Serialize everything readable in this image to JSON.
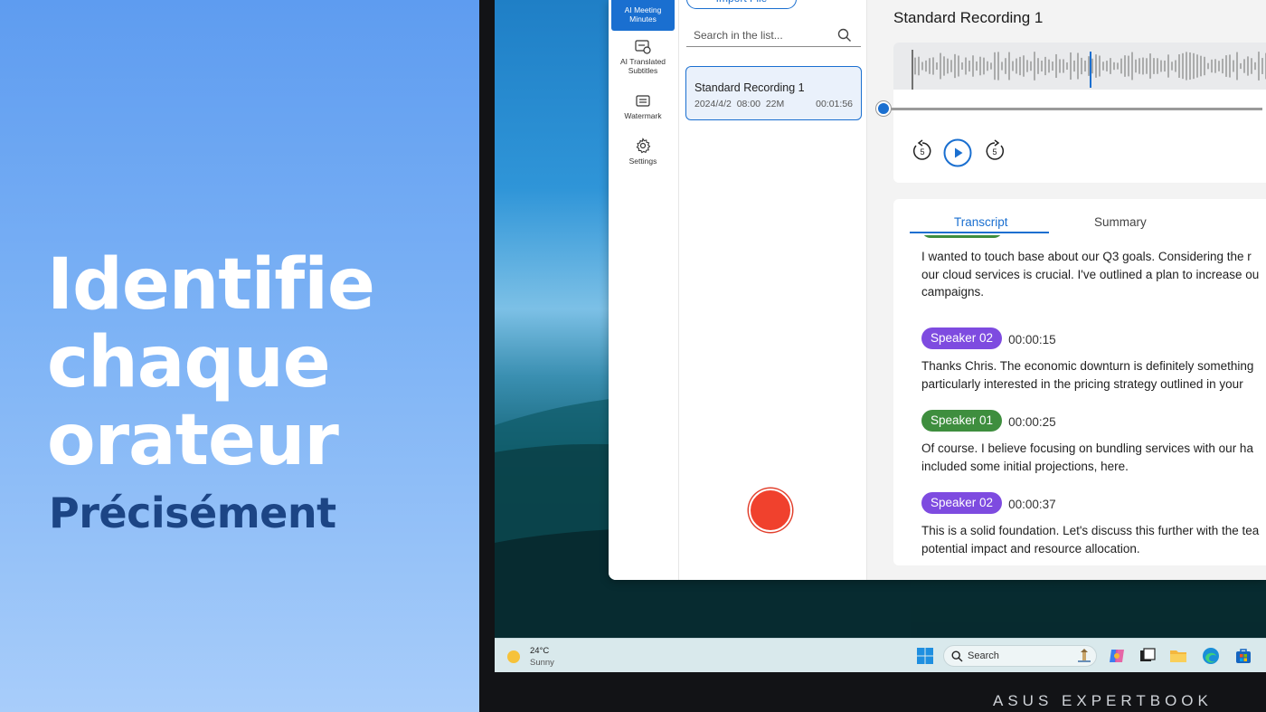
{
  "promo": {
    "line1": "Identifie",
    "line2": "chaque",
    "line3": "orateur",
    "subtitle": "Précisément"
  },
  "brand": "ASUS EXPERTBOOK",
  "nav": {
    "items": [
      {
        "label": "AI Meeting Minutes",
        "icon": "meeting-minutes-icon",
        "active": true
      },
      {
        "label": "AI Translated Subtitles",
        "icon": "translated-subtitles-icon"
      },
      {
        "label": "Watermark",
        "icon": "watermark-icon"
      },
      {
        "label": "Settings",
        "icon": "gear-icon"
      }
    ]
  },
  "list": {
    "import_label": "Import File",
    "search_placeholder": "Search in the list...",
    "recordings": [
      {
        "name": "Standard Recording 1",
        "date": "2024/4/2",
        "time": "08:00",
        "size": "22M",
        "duration": "00:01:56"
      }
    ]
  },
  "detail": {
    "title": "Standard Recording 1",
    "player": {
      "progress": 0.0,
      "rewind_seconds": "5",
      "forward_seconds": "5"
    },
    "tabs": {
      "transcript": "Transcript",
      "summary": "Summary"
    },
    "transcript": [
      {
        "speaker": "",
        "time": "",
        "lines": [
          "I wanted to touch base about our Q3 goals. Considering the r",
          "our cloud services is crucial. I've outlined a plan to increase ou",
          "campaigns."
        ]
      },
      {
        "speaker": "Speaker 02",
        "time": "00:00:15",
        "lines": [
          "Thanks Chris. The economic downturn is definitely something",
          "particularly interested in the pricing strategy outlined in your"
        ]
      },
      {
        "speaker": "Speaker 01",
        "time": "00:00:25",
        "lines": [
          "Of course. I believe focusing on bundling services with our ha",
          "included some initial projections, here."
        ]
      },
      {
        "speaker": "Speaker 02",
        "time": "00:00:37",
        "lines": [
          "This is a solid foundation. Let's discuss this further with the tea",
          "potential impact and resource allocation."
        ]
      }
    ]
  },
  "taskbar": {
    "temperature": "24°C",
    "condition": "Sunny",
    "search_label": "Search"
  },
  "colors": {
    "accent": "#1a6fd0",
    "speaker01": "#3e8e3e",
    "speaker02": "#7e4be0",
    "record": "#f0412d"
  }
}
